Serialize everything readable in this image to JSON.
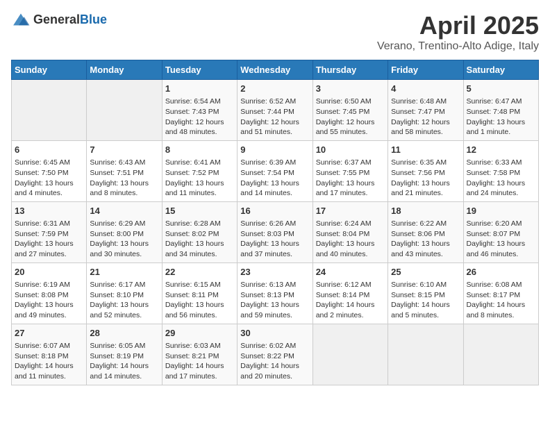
{
  "header": {
    "logo_general": "General",
    "logo_blue": "Blue",
    "month": "April 2025",
    "location": "Verano, Trentino-Alto Adige, Italy"
  },
  "weekdays": [
    "Sunday",
    "Monday",
    "Tuesday",
    "Wednesday",
    "Thursday",
    "Friday",
    "Saturday"
  ],
  "weeks": [
    [
      {
        "day": "",
        "empty": true
      },
      {
        "day": "",
        "empty": true
      },
      {
        "day": "1",
        "sunrise": "Sunrise: 6:54 AM",
        "sunset": "Sunset: 7:43 PM",
        "daylight": "Daylight: 12 hours and 48 minutes."
      },
      {
        "day": "2",
        "sunrise": "Sunrise: 6:52 AM",
        "sunset": "Sunset: 7:44 PM",
        "daylight": "Daylight: 12 hours and 51 minutes."
      },
      {
        "day": "3",
        "sunrise": "Sunrise: 6:50 AM",
        "sunset": "Sunset: 7:45 PM",
        "daylight": "Daylight: 12 hours and 55 minutes."
      },
      {
        "day": "4",
        "sunrise": "Sunrise: 6:48 AM",
        "sunset": "Sunset: 7:47 PM",
        "daylight": "Daylight: 12 hours and 58 minutes."
      },
      {
        "day": "5",
        "sunrise": "Sunrise: 6:47 AM",
        "sunset": "Sunset: 7:48 PM",
        "daylight": "Daylight: 13 hours and 1 minute."
      }
    ],
    [
      {
        "day": "6",
        "sunrise": "Sunrise: 6:45 AM",
        "sunset": "Sunset: 7:50 PM",
        "daylight": "Daylight: 13 hours and 4 minutes."
      },
      {
        "day": "7",
        "sunrise": "Sunrise: 6:43 AM",
        "sunset": "Sunset: 7:51 PM",
        "daylight": "Daylight: 13 hours and 8 minutes."
      },
      {
        "day": "8",
        "sunrise": "Sunrise: 6:41 AM",
        "sunset": "Sunset: 7:52 PM",
        "daylight": "Daylight: 13 hours and 11 minutes."
      },
      {
        "day": "9",
        "sunrise": "Sunrise: 6:39 AM",
        "sunset": "Sunset: 7:54 PM",
        "daylight": "Daylight: 13 hours and 14 minutes."
      },
      {
        "day": "10",
        "sunrise": "Sunrise: 6:37 AM",
        "sunset": "Sunset: 7:55 PM",
        "daylight": "Daylight: 13 hours and 17 minutes."
      },
      {
        "day": "11",
        "sunrise": "Sunrise: 6:35 AM",
        "sunset": "Sunset: 7:56 PM",
        "daylight": "Daylight: 13 hours and 21 minutes."
      },
      {
        "day": "12",
        "sunrise": "Sunrise: 6:33 AM",
        "sunset": "Sunset: 7:58 PM",
        "daylight": "Daylight: 13 hours and 24 minutes."
      }
    ],
    [
      {
        "day": "13",
        "sunrise": "Sunrise: 6:31 AM",
        "sunset": "Sunset: 7:59 PM",
        "daylight": "Daylight: 13 hours and 27 minutes."
      },
      {
        "day": "14",
        "sunrise": "Sunrise: 6:29 AM",
        "sunset": "Sunset: 8:00 PM",
        "daylight": "Daylight: 13 hours and 30 minutes."
      },
      {
        "day": "15",
        "sunrise": "Sunrise: 6:28 AM",
        "sunset": "Sunset: 8:02 PM",
        "daylight": "Daylight: 13 hours and 34 minutes."
      },
      {
        "day": "16",
        "sunrise": "Sunrise: 6:26 AM",
        "sunset": "Sunset: 8:03 PM",
        "daylight": "Daylight: 13 hours and 37 minutes."
      },
      {
        "day": "17",
        "sunrise": "Sunrise: 6:24 AM",
        "sunset": "Sunset: 8:04 PM",
        "daylight": "Daylight: 13 hours and 40 minutes."
      },
      {
        "day": "18",
        "sunrise": "Sunrise: 6:22 AM",
        "sunset": "Sunset: 8:06 PM",
        "daylight": "Daylight: 13 hours and 43 minutes."
      },
      {
        "day": "19",
        "sunrise": "Sunrise: 6:20 AM",
        "sunset": "Sunset: 8:07 PM",
        "daylight": "Daylight: 13 hours and 46 minutes."
      }
    ],
    [
      {
        "day": "20",
        "sunrise": "Sunrise: 6:19 AM",
        "sunset": "Sunset: 8:08 PM",
        "daylight": "Daylight: 13 hours and 49 minutes."
      },
      {
        "day": "21",
        "sunrise": "Sunrise: 6:17 AM",
        "sunset": "Sunset: 8:10 PM",
        "daylight": "Daylight: 13 hours and 52 minutes."
      },
      {
        "day": "22",
        "sunrise": "Sunrise: 6:15 AM",
        "sunset": "Sunset: 8:11 PM",
        "daylight": "Daylight: 13 hours and 56 minutes."
      },
      {
        "day": "23",
        "sunrise": "Sunrise: 6:13 AM",
        "sunset": "Sunset: 8:13 PM",
        "daylight": "Daylight: 13 hours and 59 minutes."
      },
      {
        "day": "24",
        "sunrise": "Sunrise: 6:12 AM",
        "sunset": "Sunset: 8:14 PM",
        "daylight": "Daylight: 14 hours and 2 minutes."
      },
      {
        "day": "25",
        "sunrise": "Sunrise: 6:10 AM",
        "sunset": "Sunset: 8:15 PM",
        "daylight": "Daylight: 14 hours and 5 minutes."
      },
      {
        "day": "26",
        "sunrise": "Sunrise: 6:08 AM",
        "sunset": "Sunset: 8:17 PM",
        "daylight": "Daylight: 14 hours and 8 minutes."
      }
    ],
    [
      {
        "day": "27",
        "sunrise": "Sunrise: 6:07 AM",
        "sunset": "Sunset: 8:18 PM",
        "daylight": "Daylight: 14 hours and 11 minutes."
      },
      {
        "day": "28",
        "sunrise": "Sunrise: 6:05 AM",
        "sunset": "Sunset: 8:19 PM",
        "daylight": "Daylight: 14 hours and 14 minutes."
      },
      {
        "day": "29",
        "sunrise": "Sunrise: 6:03 AM",
        "sunset": "Sunset: 8:21 PM",
        "daylight": "Daylight: 14 hours and 17 minutes."
      },
      {
        "day": "30",
        "sunrise": "Sunrise: 6:02 AM",
        "sunset": "Sunset: 8:22 PM",
        "daylight": "Daylight: 14 hours and 20 minutes."
      },
      {
        "day": "",
        "empty": true
      },
      {
        "day": "",
        "empty": true
      },
      {
        "day": "",
        "empty": true
      }
    ]
  ]
}
